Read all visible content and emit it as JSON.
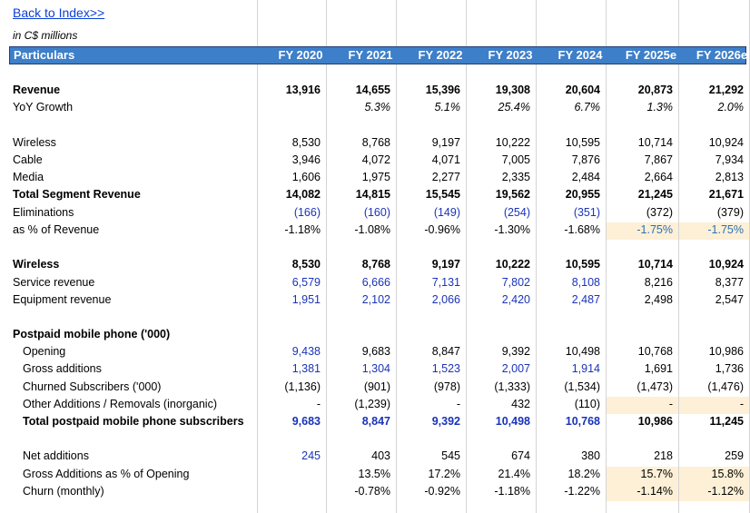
{
  "back_link": "Back to Index>>",
  "units": "in C$ millions",
  "header": {
    "particulars": "Particulars",
    "years": [
      "FY 2020",
      "FY 2021",
      "FY 2022",
      "FY 2023",
      "FY 2024",
      "FY 2025e",
      "FY 2026e"
    ]
  },
  "colors": {
    "header_bg": "#3d7fc9",
    "input_blue": "#1a33b8",
    "highlight": "#fdf0d6"
  },
  "rows": [
    {
      "label": "Revenue",
      "bold": true,
      "values": [
        "13,916",
        "14,655",
        "15,396",
        "19,308",
        "20,604",
        "20,873",
        "21,292"
      ]
    },
    {
      "label": "YoY Growth",
      "ital": true,
      "values": [
        "",
        "5.3%",
        "5.1%",
        "25.4%",
        "6.7%",
        "1.3%",
        "2.0%"
      ]
    },
    {
      "label": "Wireless",
      "values": [
        "8,530",
        "8,768",
        "9,197",
        "10,222",
        "10,595",
        "10,714",
        "10,924"
      ]
    },
    {
      "label": "Cable",
      "values": [
        "3,946",
        "4,072",
        "4,071",
        "7,005",
        "7,876",
        "7,867",
        "7,934"
      ]
    },
    {
      "label": "Media",
      "values": [
        "1,606",
        "1,975",
        "2,277",
        "2,335",
        "2,484",
        "2,664",
        "2,813"
      ]
    },
    {
      "label": "Total Segment Revenue",
      "bold": true,
      "values": [
        "14,082",
        "14,815",
        "15,545",
        "19,562",
        "20,955",
        "21,245",
        "21,671"
      ]
    },
    {
      "label": "Eliminations",
      "values": [
        "(166)",
        "(160)",
        "(149)",
        "(254)",
        "(351)",
        "(372)",
        "(379)"
      ]
    },
    {
      "label": "as % of Revenue",
      "values": [
        "-1.18%",
        "-1.08%",
        "-0.96%",
        "-1.30%",
        "-1.68%",
        "-1.75%",
        "-1.75%"
      ]
    },
    {
      "label": "Wireless",
      "bold": true,
      "values": [
        "8,530",
        "8,768",
        "9,197",
        "10,222",
        "10,595",
        "10,714",
        "10,924"
      ]
    },
    {
      "label": "Service revenue",
      "values": [
        "6,579",
        "6,666",
        "7,131",
        "7,802",
        "8,108",
        "8,216",
        "8,377"
      ]
    },
    {
      "label": "Equipment revenue",
      "values": [
        "1,951",
        "2,102",
        "2,066",
        "2,420",
        "2,487",
        "2,498",
        "2,547"
      ]
    },
    {
      "label": "Postpaid mobile phone ('000)",
      "bold": true,
      "values": [
        "",
        "",
        "",
        "",
        "",
        "",
        ""
      ]
    },
    {
      "label": "Opening",
      "values": [
        "9,438",
        "9,683",
        "8,847",
        "9,392",
        "10,498",
        "10,768",
        "10,986"
      ]
    },
    {
      "label": "Gross additions",
      "values": [
        "1,381",
        "1,304",
        "1,523",
        "2,007",
        "1,914",
        "1,691",
        "1,736"
      ]
    },
    {
      "label": "Churned Subscribers ('000)",
      "values": [
        "(1,136)",
        "(901)",
        "(978)",
        "(1,333)",
        "(1,534)",
        "(1,473)",
        "(1,476)"
      ]
    },
    {
      "label": "Other Additions / Removals (inorganic)",
      "values": [
        "-",
        "(1,239)",
        "-",
        "432",
        "(110)",
        "-",
        "-"
      ]
    },
    {
      "label": "Total postpaid mobile phone subscribers",
      "bold": true,
      "values": [
        "9,683",
        "8,847",
        "9,392",
        "10,498",
        "10,768",
        "10,986",
        "11,245"
      ]
    },
    {
      "label": "Net additions",
      "values": [
        "245",
        "403",
        "545",
        "674",
        "380",
        "218",
        "259"
      ]
    },
    {
      "label": "Gross Additions as % of Opening",
      "values": [
        "",
        "13.5%",
        "17.2%",
        "21.4%",
        "18.2%",
        "15.7%",
        "15.8%"
      ]
    },
    {
      "label": "Churn (monthly)",
      "values": [
        "",
        "-0.78%",
        "-0.92%",
        "-1.18%",
        "-1.22%",
        "-1.14%",
        "-1.12%"
      ]
    }
  ]
}
